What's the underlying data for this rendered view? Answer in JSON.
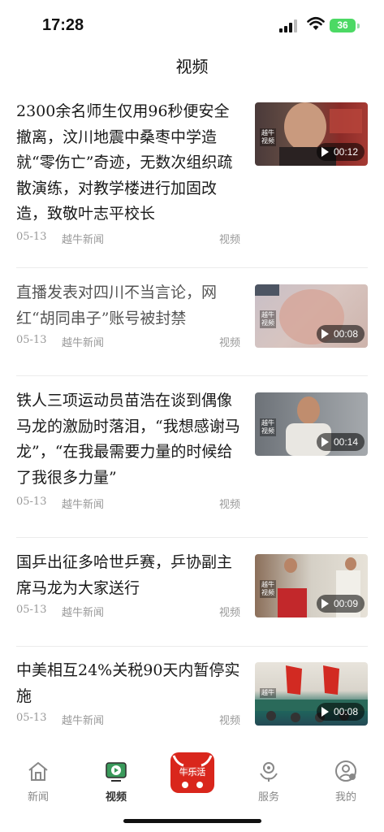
{
  "status_bar": {
    "time": "17:28",
    "battery": "36"
  },
  "header": {
    "title": "视频"
  },
  "news": [
    {
      "title": "2300余名师生仅用96秒便安全撤离，汶川地震中桑枣中学造就“零伤亡”奇迹，无数次组织疏散演练，对教学楼进行加固改造，致敬叶志平校长",
      "date": "05-13",
      "source": "越牛新闻",
      "type": "视频",
      "duration": "00:12",
      "thumb_label": "越牛\n视频"
    },
    {
      "title": "直播发表对四川不当言论，网红“胡同串子”账号被封禁",
      "date": "05-13",
      "source": "越牛新闻",
      "type": "视频",
      "duration": "00:08",
      "thumb_label": "越牛\n视频"
    },
    {
      "title": "铁人三项运动员苗浩在谈到偶像马龙的激励时落泪，“我想感谢马龙”，“在我最需要力量的时候给了我很多力量”",
      "date": "05-13",
      "source": "越牛新闻",
      "type": "视频",
      "duration": "00:14",
      "thumb_label": "越牛\n视频"
    },
    {
      "title": "国乒出征多哈世乒赛，乒协副主席马龙为大家送行",
      "date": "05-13",
      "source": "越牛新闻",
      "type": "视频",
      "duration": "00:09",
      "thumb_label": "越牛\n视频"
    },
    {
      "title": "中美相互24%关税90天内暂停实施",
      "date": "05-13",
      "source": "越牛新闻",
      "type": "视频",
      "duration": "00:08",
      "thumb_label": "越牛"
    }
  ],
  "tabs": [
    {
      "label": "新闻",
      "icon": "home-icon",
      "active": false
    },
    {
      "label": "视频",
      "icon": "tv-icon",
      "active": true
    },
    {
      "label": "",
      "icon": "niu-logo",
      "active": false
    },
    {
      "label": "服务",
      "icon": "service-icon",
      "active": false
    },
    {
      "label": "我的",
      "icon": "profile-icon",
      "active": false
    }
  ],
  "colors": {
    "accent_red": "#d9261c",
    "battery_green": "#4cd964",
    "active_tab_green": "#3a9a5b"
  }
}
